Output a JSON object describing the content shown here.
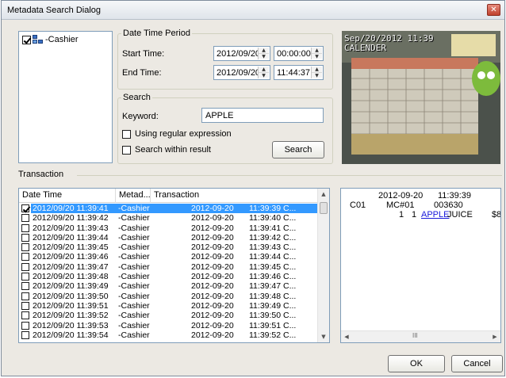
{
  "window": {
    "title": "Metadata Search Dialog",
    "close_glyph": "✕"
  },
  "tree": {
    "items": [
      {
        "label": "-Cashier",
        "checked": true,
        "icon": "network-icon"
      }
    ]
  },
  "datetime": {
    "legend": "Date Time Period",
    "start_label": "Start Time:",
    "start_date": "2012/09/20",
    "start_time": "00:00:00",
    "end_label": "End Time:",
    "end_date": "2012/09/20",
    "end_time": "11:44:37"
  },
  "search": {
    "legend": "Search",
    "keyword_label": "Keyword:",
    "keyword_value": "APPLE",
    "regex_label": "Using regular expression",
    "within_label": "Search within result",
    "button_label": "Search"
  },
  "preview": {
    "osd_line1": "Sep/20/2012 11:39",
    "osd_line2": "CALENDER"
  },
  "transaction": {
    "section_label": "Transaction",
    "columns": [
      "Date Time",
      "Metad...",
      "Transaction"
    ],
    "rows": [
      {
        "dt": "2012/09/20 11:39:41",
        "meta": "-Cashier",
        "tdate": "2012-09-20",
        "ttime": "11:39:39  C...",
        "checked": true,
        "selected": true
      },
      {
        "dt": "2012/09/20 11:39:42",
        "meta": "-Cashier",
        "tdate": "2012-09-20",
        "ttime": "11:39:40  C...",
        "checked": false,
        "selected": false
      },
      {
        "dt": "2012/09/20 11:39:43",
        "meta": "-Cashier",
        "tdate": "2012-09-20",
        "ttime": "11:39:41  C...",
        "checked": false,
        "selected": false
      },
      {
        "dt": "2012/09/20 11:39:44",
        "meta": "-Cashier",
        "tdate": "2012-09-20",
        "ttime": "11:39:42  C...",
        "checked": false,
        "selected": false
      },
      {
        "dt": "2012/09/20 11:39:45",
        "meta": "-Cashier",
        "tdate": "2012-09-20",
        "ttime": "11:39:43  C...",
        "checked": false,
        "selected": false
      },
      {
        "dt": "2012/09/20 11:39:46",
        "meta": "-Cashier",
        "tdate": "2012-09-20",
        "ttime": "11:39:44  C...",
        "checked": false,
        "selected": false
      },
      {
        "dt": "2012/09/20 11:39:47",
        "meta": "-Cashier",
        "tdate": "2012-09-20",
        "ttime": "11:39:45  C...",
        "checked": false,
        "selected": false
      },
      {
        "dt": "2012/09/20 11:39:48",
        "meta": "-Cashier",
        "tdate": "2012-09-20",
        "ttime": "11:39:46  C...",
        "checked": false,
        "selected": false
      },
      {
        "dt": "2012/09/20 11:39:49",
        "meta": "-Cashier",
        "tdate": "2012-09-20",
        "ttime": "11:39:47  C...",
        "checked": false,
        "selected": false
      },
      {
        "dt": "2012/09/20 11:39:50",
        "meta": "-Cashier",
        "tdate": "2012-09-20",
        "ttime": "11:39:48  C...",
        "checked": false,
        "selected": false
      },
      {
        "dt": "2012/09/20 11:39:51",
        "meta": "-Cashier",
        "tdate": "2012-09-20",
        "ttime": "11:39:49  C...",
        "checked": false,
        "selected": false
      },
      {
        "dt": "2012/09/20 11:39:52",
        "meta": "-Cashier",
        "tdate": "2012-09-20",
        "ttime": "11:39:50  C...",
        "checked": false,
        "selected": false
      },
      {
        "dt": "2012/09/20 11:39:53",
        "meta": "-Cashier",
        "tdate": "2012-09-20",
        "ttime": "11:39:51  C...",
        "checked": false,
        "selected": false
      },
      {
        "dt": "2012/09/20 11:39:54",
        "meta": "-Cashier",
        "tdate": "2012-09-20",
        "ttime": "11:39:52  C...",
        "checked": false,
        "selected": false
      }
    ]
  },
  "detail": {
    "date": "2012-09-20",
    "time": "11:39:39",
    "c01": "C01",
    "mc": "MC#01",
    "num": "003630",
    "qty1": "1",
    "qty2": "1",
    "item_link": "APPLE",
    "item_rest": "JUICE",
    "price": "$8"
  },
  "footer": {
    "ok_label": "OK",
    "cancel_label": "Cancel"
  },
  "colors": {
    "selection": "#3399ff",
    "dialog_bg": "#ece9e3",
    "border": "#7f9db9"
  }
}
